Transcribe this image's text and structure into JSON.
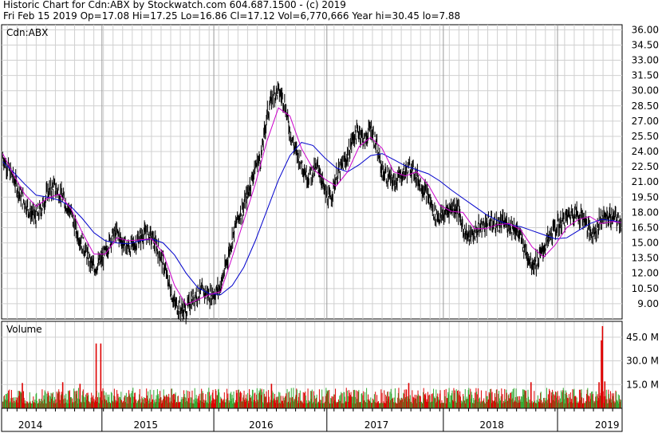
{
  "header": {
    "line1": "Historic Chart for Cdn:ABX by Stockwatch.com 604.687.1500 - (c) 2019",
    "line2": "Fri Feb 15 2019   Op=17.08   Hi=17.25   Lo=16.86   Cl=17.12   Vol=6,770,666   Year hi=30.45   lo=7.88"
  },
  "colors": {
    "price": "#000000",
    "ma_short": "#cc00cc",
    "ma_long": "#0000cc",
    "volume_up": "#33aa33",
    "volume_down": "#dd0000",
    "grid": "#d0d0d0",
    "panel_border": "#000000"
  },
  "chart_data": [
    {
      "type": "line",
      "panel": "price",
      "label": "Cdn:ABX",
      "y_ticks": [
        9.0,
        10.5,
        12.0,
        13.5,
        15.0,
        16.5,
        18.0,
        19.5,
        21.0,
        22.5,
        24.0,
        25.5,
        27.0,
        28.5,
        30.0,
        31.5,
        33.0,
        34.5,
        36.0
      ],
      "y_tick_labels": [
        "9.00",
        "10.50",
        "12.00",
        "13.50",
        "15.00",
        "16.50",
        "18.00",
        "19.50",
        "21.00",
        "22.50",
        "24.00",
        "25.50",
        "27.00",
        "28.50",
        "30.00",
        "31.50",
        "33.00",
        "34.50",
        "36.00"
      ],
      "ylim": [
        7.5,
        36.5
      ],
      "xlim": [
        2013.75,
        2019.13
      ],
      "year_labels": [
        {
          "label": "2014",
          "x": 2014.0
        },
        {
          "label": "2015",
          "x": 2015.0
        },
        {
          "label": "2016",
          "x": 2016.0
        },
        {
          "label": "2017",
          "x": 2017.0
        },
        {
          "label": "2018",
          "x": 2018.0
        },
        {
          "label": "2019",
          "x": 2019.0
        }
      ],
      "year_boundaries": [
        2014.62,
        2015.59,
        2016.57,
        2017.58,
        2018.57
      ],
      "grid": true,
      "series": [
        {
          "role": "price",
          "x": [
            2013.76,
            2013.8,
            2013.85,
            2013.9,
            2013.95,
            2014.0,
            2014.05,
            2014.1,
            2014.15,
            2014.2,
            2014.25,
            2014.3,
            2014.35,
            2014.4,
            2014.45,
            2014.5,
            2014.55,
            2014.6,
            2014.65,
            2014.7,
            2014.75,
            2014.8,
            2014.85,
            2014.9,
            2014.95,
            2015.0,
            2015.05,
            2015.1,
            2015.15,
            2015.2,
            2015.25,
            2015.3,
            2015.35,
            2015.4,
            2015.45,
            2015.5,
            2015.55,
            2015.6,
            2015.65,
            2015.7,
            2015.75,
            2015.8,
            2015.85,
            2015.9,
            2015.95,
            2016.0,
            2016.05,
            2016.1,
            2016.15,
            2016.2,
            2016.25,
            2016.3,
            2016.35,
            2016.4,
            2016.45,
            2016.5,
            2016.55,
            2016.6,
            2016.65,
            2016.7,
            2016.75,
            2016.8,
            2016.85,
            2016.9,
            2016.95,
            2017.0,
            2017.05,
            2017.1,
            2017.15,
            2017.2,
            2017.25,
            2017.3,
            2017.35,
            2017.4,
            2017.45,
            2017.5,
            2017.55,
            2017.6,
            2017.65,
            2017.7,
            2017.75,
            2017.8,
            2017.85,
            2017.9,
            2017.95,
            2018.0,
            2018.05,
            2018.1,
            2018.15,
            2018.2,
            2018.25,
            2018.3,
            2018.35,
            2018.4,
            2018.45,
            2018.5,
            2018.55,
            2018.6,
            2018.65,
            2018.7,
            2018.75,
            2018.8,
            2018.85,
            2018.9,
            2018.95,
            2019.0,
            2019.05,
            2019.1,
            2019.12
          ],
          "y": [
            23.5,
            22.5,
            21.5,
            20.0,
            19.0,
            18.0,
            17.5,
            18.5,
            20.0,
            20.5,
            20.0,
            19.0,
            18.0,
            16.0,
            15.0,
            13.5,
            12.5,
            13.0,
            14.0,
            15.5,
            16.0,
            15.0,
            14.5,
            14.8,
            15.5,
            16.0,
            15.5,
            14.5,
            13.0,
            11.0,
            9.0,
            8.5,
            8.3,
            9.5,
            10.0,
            10.2,
            9.8,
            10.0,
            10.8,
            13.0,
            15.5,
            17.5,
            18.5,
            20.5,
            22.5,
            23.5,
            27.5,
            29.5,
            30.0,
            29.0,
            26.0,
            24.0,
            23.0,
            21.5,
            22.0,
            22.5,
            20.0,
            19.2,
            21.5,
            22.5,
            23.5,
            25.5,
            26.0,
            25.0,
            26.5,
            24.5,
            22.0,
            21.5,
            21.0,
            21.5,
            22.0,
            22.5,
            21.5,
            20.5,
            19.5,
            18.0,
            17.5,
            18.0,
            18.5,
            18.5,
            16.5,
            15.5,
            16.0,
            16.5,
            17.0,
            17.0,
            16.8,
            17.0,
            16.8,
            16.5,
            15.5,
            14.0,
            13.0,
            13.2,
            14.5,
            15.5,
            16.5,
            17.0,
            17.5,
            18.0,
            17.8,
            17.5,
            16.0,
            16.2,
            17.5,
            17.6,
            17.5,
            17.3,
            17.12
          ],
          "high_low_spread": 0.9
        },
        {
          "role": "ma_short",
          "x": [
            2013.76,
            2013.85,
            2013.95,
            2014.05,
            2014.15,
            2014.25,
            2014.35,
            2014.45,
            2014.55,
            2014.65,
            2014.75,
            2014.85,
            2014.95,
            2015.05,
            2015.15,
            2015.25,
            2015.35,
            2015.45,
            2015.55,
            2015.65,
            2015.75,
            2015.85,
            2015.95,
            2016.05,
            2016.15,
            2016.25,
            2016.35,
            2016.45,
            2016.55,
            2016.65,
            2016.75,
            2016.85,
            2016.95,
            2017.05,
            2017.15,
            2017.25,
            2017.35,
            2017.45,
            2017.55,
            2017.65,
            2017.75,
            2017.85,
            2017.95,
            2018.05,
            2018.15,
            2018.25,
            2018.35,
            2018.45,
            2018.55,
            2018.65,
            2018.75,
            2018.85,
            2018.95,
            2019.05,
            2019.12
          ],
          "y": [
            23.8,
            21.8,
            19.8,
            18.6,
            19.4,
            19.8,
            18.4,
            16.0,
            13.9,
            13.9,
            15.5,
            15.2,
            15.3,
            15.4,
            14.0,
            10.8,
            8.9,
            9.4,
            9.9,
            10.2,
            13.6,
            17.2,
            20.8,
            25.0,
            28.3,
            27.5,
            24.3,
            22.3,
            21.3,
            20.6,
            22.0,
            24.5,
            25.4,
            24.3,
            22.0,
            21.6,
            22.0,
            20.7,
            18.7,
            18.1,
            18.0,
            16.4,
            16.4,
            16.8,
            16.9,
            16.3,
            14.6,
            13.6,
            14.8,
            16.5,
            17.3,
            17.6,
            16.9,
            17.1,
            17.0
          ]
        },
        {
          "role": "ma_long",
          "x": [
            2013.76,
            2013.85,
            2013.95,
            2014.05,
            2014.15,
            2014.25,
            2014.35,
            2014.45,
            2014.55,
            2014.65,
            2014.75,
            2014.85,
            2014.95,
            2015.05,
            2015.15,
            2015.25,
            2015.35,
            2015.45,
            2015.55,
            2015.65,
            2015.75,
            2015.85,
            2015.95,
            2016.05,
            2016.15,
            2016.25,
            2016.35,
            2016.45,
            2016.55,
            2016.65,
            2016.75,
            2016.85,
            2016.95,
            2017.05,
            2017.15,
            2017.25,
            2017.35,
            2017.45,
            2017.55,
            2017.65,
            2017.75,
            2017.85,
            2017.95,
            2018.05,
            2018.15,
            2018.25,
            2018.35,
            2018.45,
            2018.55,
            2018.65,
            2018.75,
            2018.85,
            2018.95,
            2019.05,
            2019.12
          ],
          "y": [
            23.0,
            22.0,
            20.8,
            19.7,
            19.5,
            19.2,
            18.6,
            17.4,
            16.0,
            15.2,
            15.0,
            14.9,
            15.2,
            15.4,
            15.0,
            13.8,
            12.0,
            10.6,
            10.0,
            9.9,
            10.8,
            12.6,
            15.2,
            18.2,
            21.2,
            23.6,
            24.9,
            24.6,
            23.4,
            22.4,
            22.0,
            22.7,
            23.6,
            23.8,
            23.2,
            22.6,
            22.2,
            21.8,
            21.1,
            20.2,
            19.4,
            18.6,
            17.8,
            17.2,
            16.8,
            16.6,
            16.2,
            15.8,
            15.4,
            15.5,
            16.2,
            16.9,
            17.3,
            17.2,
            17.0
          ]
        }
      ]
    },
    {
      "type": "bar",
      "panel": "volume",
      "label": "Volume",
      "y_ticks": [
        15.0,
        30.0,
        45.0
      ],
      "y_tick_labels": [
        "15.0 M",
        "30.0 M",
        "45.0 M"
      ],
      "ylim": [
        0,
        55
      ],
      "typical_volume_range": [
        3.0,
        13.0
      ],
      "spikes": [
        {
          "x": 2014.57,
          "value": 41.0
        },
        {
          "x": 2014.61,
          "value": 41.0
        },
        {
          "x": 2013.93,
          "value": 16.0
        },
        {
          "x": 2014.28,
          "value": 16.5
        },
        {
          "x": 2014.43,
          "value": 15.5
        },
        {
          "x": 2016.09,
          "value": 15.5
        },
        {
          "x": 2017.28,
          "value": 16.0
        },
        {
          "x": 2018.34,
          "value": 16.5
        },
        {
          "x": 2018.96,
          "value": 52.0
        },
        {
          "x": 2018.95,
          "value": 43.0
        },
        {
          "x": 2018.98,
          "value": 17.0
        },
        {
          "x": 2018.93,
          "value": 16.5
        }
      ]
    }
  ]
}
